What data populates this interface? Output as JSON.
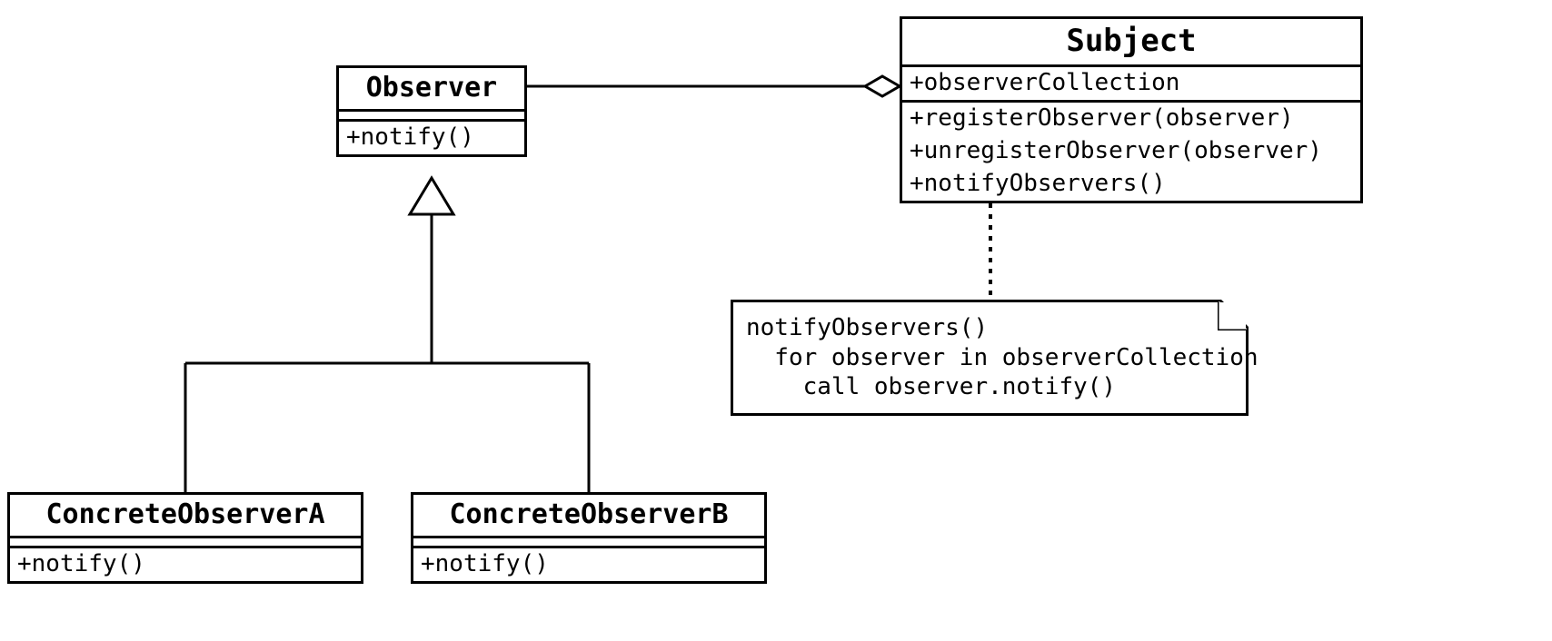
{
  "classes": {
    "observer": {
      "name": "Observer",
      "methods": [
        "+notify()"
      ]
    },
    "subject": {
      "name": "Subject",
      "attributes": [
        "+observerCollection"
      ],
      "methods": [
        "+registerObserver(observer)",
        "+unregisterObserver(observer)",
        "+notifyObservers()"
      ]
    },
    "concreteA": {
      "name": "ConcreteObserverA",
      "methods": [
        "+notify()"
      ]
    },
    "concreteB": {
      "name": "ConcreteObserverB",
      "methods": [
        "+notify()"
      ]
    }
  },
  "note": {
    "lines": [
      "notifyObservers()",
      "  for observer in observerCollection",
      "    call observer.notify()"
    ]
  },
  "relationships": [
    {
      "type": "aggregation",
      "from": "Subject",
      "to": "Observer"
    },
    {
      "type": "generalization",
      "parent": "Observer",
      "child": "ConcreteObserverA"
    },
    {
      "type": "generalization",
      "parent": "Observer",
      "child": "ConcreteObserverB"
    },
    {
      "type": "note-link",
      "from": "Subject",
      "to": "note"
    }
  ],
  "chart_data": {
    "type": "uml-class-diagram",
    "pattern": "Observer",
    "classes": [
      {
        "name": "Observer",
        "attributes": [],
        "methods": [
          "notify()"
        ]
      },
      {
        "name": "Subject",
        "attributes": [
          "observerCollection"
        ],
        "methods": [
          "registerObserver(observer)",
          "unregisterObserver(observer)",
          "notifyObservers()"
        ]
      },
      {
        "name": "ConcreteObserverA",
        "attributes": [],
        "methods": [
          "notify()"
        ]
      },
      {
        "name": "ConcreteObserverB",
        "attributes": [],
        "methods": [
          "notify()"
        ]
      }
    ],
    "relations": [
      {
        "type": "aggregation",
        "whole": "Subject",
        "part": "Observer"
      },
      {
        "type": "generalization",
        "parent": "Observer",
        "child": "ConcreteObserverA"
      },
      {
        "type": "generalization",
        "parent": "Observer",
        "child": "ConcreteObserverB"
      }
    ],
    "note": "notifyObservers(): for observer in observerCollection call observer.notify()"
  }
}
